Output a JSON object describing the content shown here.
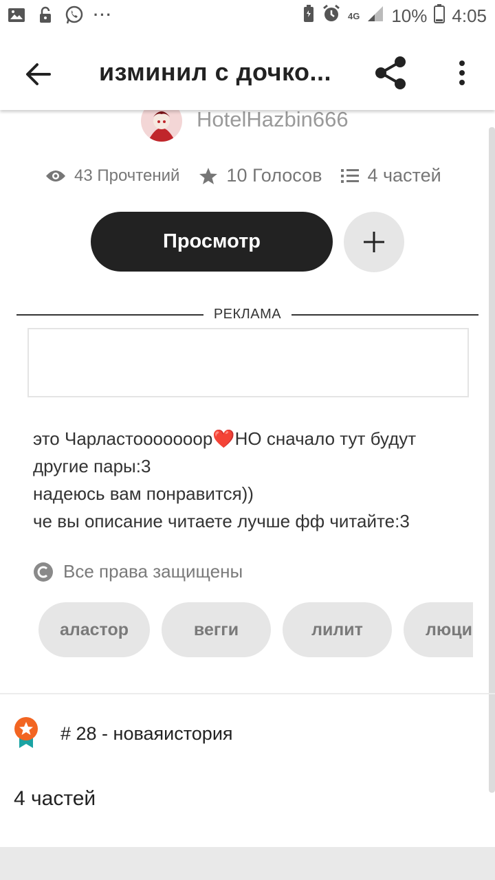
{
  "status_bar": {
    "battery": "10%",
    "time": "4:05",
    "network": "4G"
  },
  "app_bar": {
    "title": "изминил с дочко..."
  },
  "story": {
    "author": "HotelHazbin666",
    "reads": "43 Прочтений",
    "votes": "10 Голосов",
    "parts": "4 частей",
    "view_button": "Просмотр",
    "ad_label": "РЕКЛАМА",
    "description": [
      "это Чарластооооооор❤️НО сначало тут будут",
      "другие пары:3",
      "надеюсь вам понравится))",
      "че вы описание читаете лучше фф читайте:3"
    ],
    "copyright": "Все права защищены",
    "tags": [
      "аластор",
      "вегги",
      "лилит",
      "люцифер"
    ],
    "ranking": "# 28 - новаяистория",
    "parts_count": "4 частей"
  },
  "colors": {
    "primary_button": "#222222",
    "muted_text": "#767676",
    "tag_bg": "#e6e6e6",
    "rank_orange": "#f26522",
    "rank_ribbon": "#1aa3a3"
  }
}
